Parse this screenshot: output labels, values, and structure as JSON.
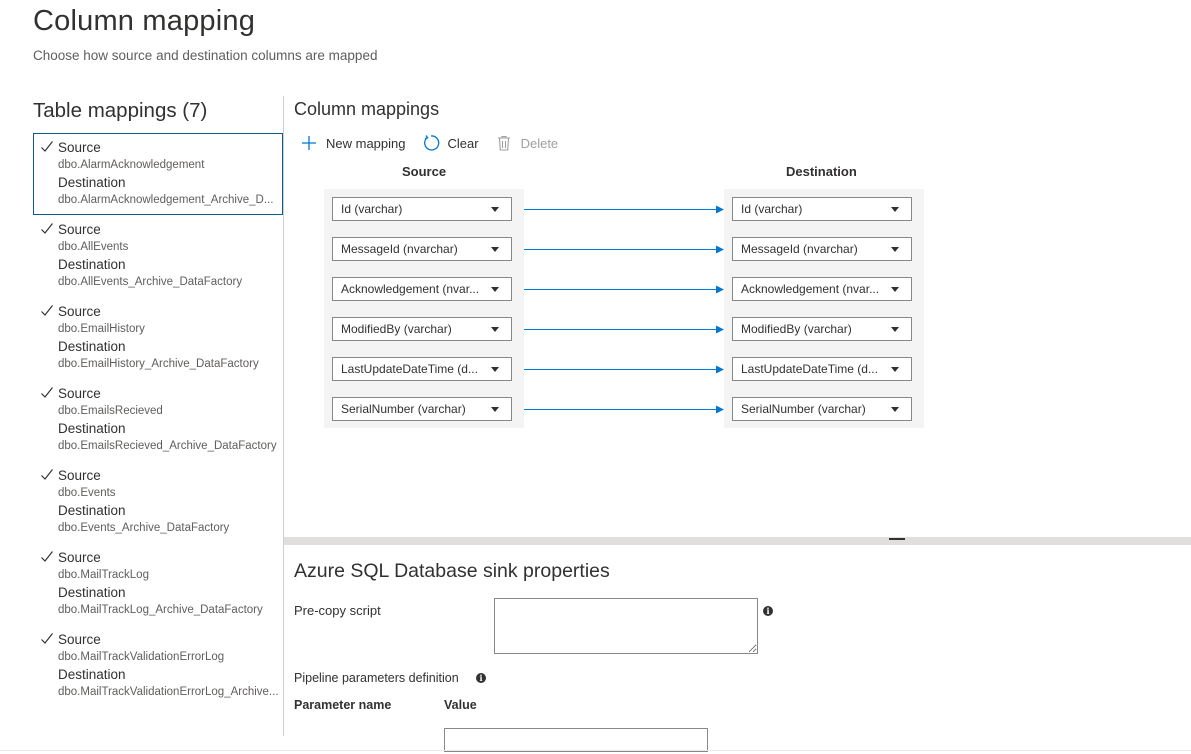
{
  "header": {
    "title": "Column mapping",
    "subtitle": "Choose how source and destination columns are mapped"
  },
  "table_mappings": {
    "title": "Table mappings (7)",
    "source_label": "Source",
    "destination_label": "Destination",
    "items": [
      {
        "source": "dbo.AlarmAcknowledgement",
        "destination": "dbo.AlarmAcknowledgement_Archive_D...",
        "checked": true,
        "selected": true
      },
      {
        "source": "dbo.AllEvents",
        "destination": "dbo.AllEvents_Archive_DataFactory",
        "checked": true,
        "selected": false
      },
      {
        "source": "dbo.EmailHistory",
        "destination": "dbo.EmailHistory_Archive_DataFactory",
        "checked": true,
        "selected": false
      },
      {
        "source": "dbo.EmailsRecieved",
        "destination": "dbo.EmailsRecieved_Archive_DataFactory",
        "checked": true,
        "selected": false
      },
      {
        "source": "dbo.Events",
        "destination": "dbo.Events_Archive_DataFactory",
        "checked": true,
        "selected": false
      },
      {
        "source": "dbo.MailTrackLog",
        "destination": "dbo.MailTrackLog_Archive_DataFactory",
        "checked": true,
        "selected": false
      },
      {
        "source": "dbo.MailTrackValidationErrorLog",
        "destination": "dbo.MailTrackValidationErrorLog_Archive...",
        "checked": true,
        "selected": false
      }
    ]
  },
  "column_mappings": {
    "title": "Column mappings",
    "toolbar": {
      "new_mapping": "New mapping",
      "clear": "Clear",
      "delete": "Delete"
    },
    "source_header": "Source",
    "destination_header": "Destination",
    "rows": [
      {
        "source": "Id (varchar)",
        "destination": "Id (varchar)"
      },
      {
        "source": "MessageId (nvarchar)",
        "destination": "MessageId (nvarchar)"
      },
      {
        "source": "Acknowledgement (nvar...",
        "destination": "Acknowledgement (nvar..."
      },
      {
        "source": "ModifiedBy (varchar)",
        "destination": "ModifiedBy (varchar)"
      },
      {
        "source": "LastUpdateDateTime (d...",
        "destination": "LastUpdateDateTime (d..."
      },
      {
        "source": "SerialNumber (varchar)",
        "destination": "SerialNumber (varchar)"
      }
    ]
  },
  "sink": {
    "title": "Azure SQL Database sink properties",
    "pre_copy_label": "Pre-copy script",
    "pre_copy_value": "",
    "pipeline_params_label": "Pipeline parameters definition",
    "param_name_header": "Parameter name",
    "value_header": "Value"
  },
  "colors": {
    "accent": "#0078d4",
    "selected_border": "#0a5a8c",
    "panel_bg": "#f4f4f4"
  }
}
